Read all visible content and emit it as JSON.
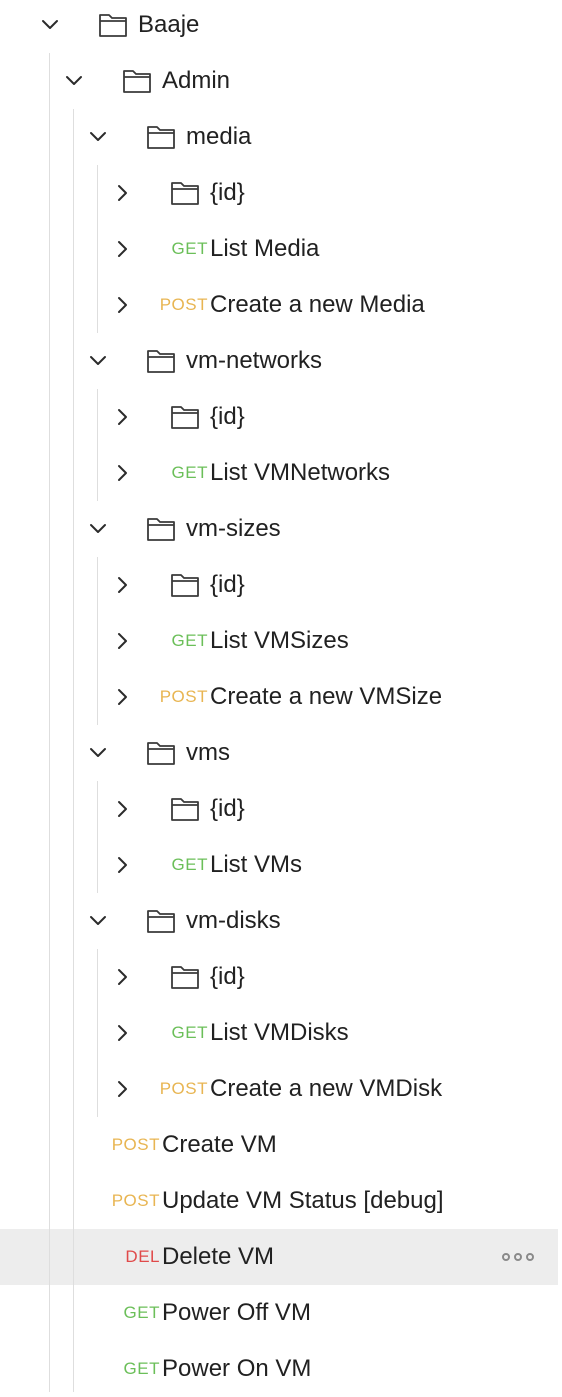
{
  "tree": [
    {
      "depth": 0,
      "kind": "folder",
      "expanded": true,
      "label": "Baaje"
    },
    {
      "depth": 1,
      "kind": "folder",
      "expanded": true,
      "label": "Admin"
    },
    {
      "depth": 2,
      "kind": "folder",
      "expanded": true,
      "label": "media"
    },
    {
      "depth": 3,
      "kind": "folder",
      "expanded": false,
      "label": "{id}"
    },
    {
      "depth": 3,
      "kind": "request",
      "expanded": false,
      "method": "GET",
      "label": "List Media"
    },
    {
      "depth": 3,
      "kind": "request",
      "expanded": false,
      "method": "POST",
      "label": "Create a new Media"
    },
    {
      "depth": 2,
      "kind": "folder",
      "expanded": true,
      "label": "vm-networks"
    },
    {
      "depth": 3,
      "kind": "folder",
      "expanded": false,
      "label": "{id}"
    },
    {
      "depth": 3,
      "kind": "request",
      "expanded": false,
      "method": "GET",
      "label": "List VMNetworks"
    },
    {
      "depth": 2,
      "kind": "folder",
      "expanded": true,
      "label": "vm-sizes"
    },
    {
      "depth": 3,
      "kind": "folder",
      "expanded": false,
      "label": "{id}"
    },
    {
      "depth": 3,
      "kind": "request",
      "expanded": false,
      "method": "GET",
      "label": "List VMSizes"
    },
    {
      "depth": 3,
      "kind": "request",
      "expanded": false,
      "method": "POST",
      "label": "Create a new VMSize"
    },
    {
      "depth": 2,
      "kind": "folder",
      "expanded": true,
      "label": "vms"
    },
    {
      "depth": 3,
      "kind": "folder",
      "expanded": false,
      "label": "{id}"
    },
    {
      "depth": 3,
      "kind": "request",
      "expanded": false,
      "method": "GET",
      "label": "List VMs"
    },
    {
      "depth": 2,
      "kind": "folder",
      "expanded": true,
      "label": "vm-disks"
    },
    {
      "depth": 3,
      "kind": "folder",
      "expanded": false,
      "label": "{id}"
    },
    {
      "depth": 3,
      "kind": "request",
      "expanded": false,
      "method": "GET",
      "label": "List VMDisks"
    },
    {
      "depth": 3,
      "kind": "request",
      "expanded": false,
      "method": "POST",
      "label": "Create a new VMDisk"
    },
    {
      "depth": 2,
      "kind": "request",
      "leaf": true,
      "method": "POST",
      "label": "Create VM"
    },
    {
      "depth": 2,
      "kind": "request",
      "leaf": true,
      "method": "POST",
      "label": "Update VM Status [debug]"
    },
    {
      "depth": 2,
      "kind": "request",
      "leaf": true,
      "method": "DEL",
      "label": "Delete VM",
      "selected": true,
      "more": true
    },
    {
      "depth": 2,
      "kind": "request",
      "leaf": true,
      "method": "GET",
      "label": "Power Off VM"
    },
    {
      "depth": 2,
      "kind": "request",
      "leaf": true,
      "method": "GET",
      "label": "Power On VM"
    }
  ],
  "colors": {
    "GET": "#6bbf59",
    "POST": "#e8b552",
    "DEL": "#e04a4a",
    "guide": "#dedede",
    "selected": "#ededed"
  },
  "icons": {
    "expanded": "chevron-down-icon",
    "collapsed": "chevron-right-icon",
    "folder": "folder-icon",
    "more": "more-options-icon"
  }
}
